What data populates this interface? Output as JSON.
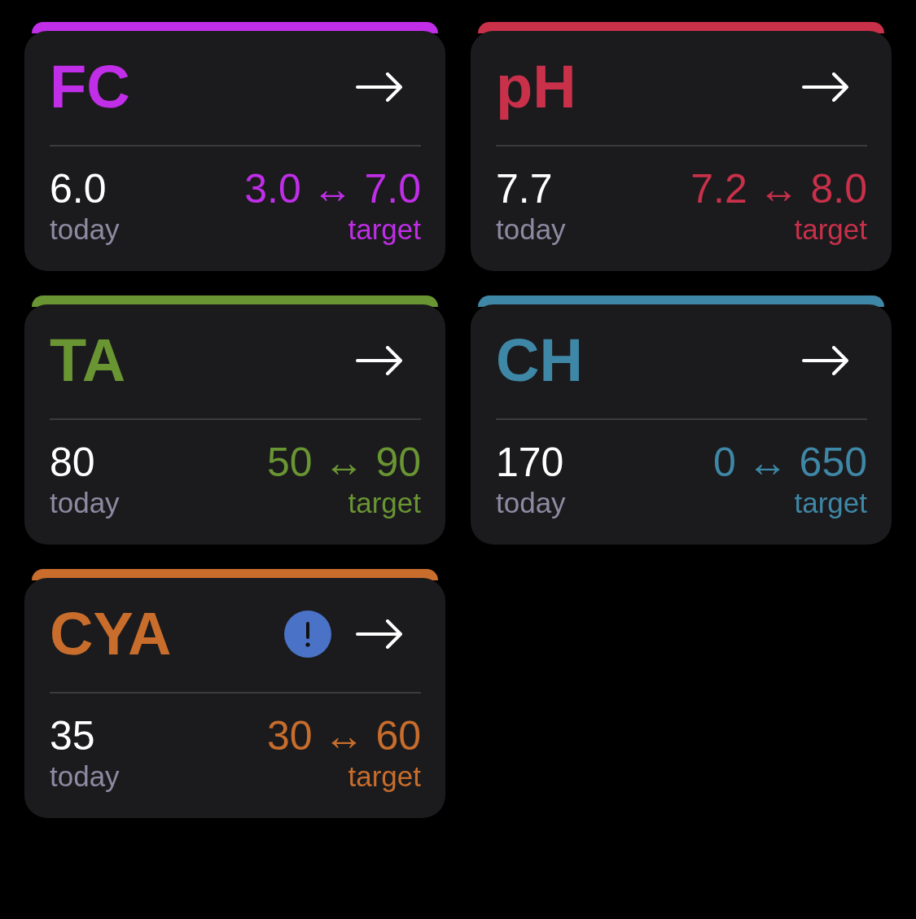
{
  "cards": [
    {
      "title": "FC",
      "color": "#c02ee8",
      "alert": false,
      "today_value": "6.0",
      "today_label": "today",
      "target_range": "3.0 ↔ 7.0",
      "target_label": "target"
    },
    {
      "title": "pH",
      "color": "#c9304a",
      "alert": false,
      "today_value": "7.7",
      "today_label": "today",
      "target_range": "7.2 ↔ 8.0",
      "target_label": "target"
    },
    {
      "title": "TA",
      "color": "#6a9533",
      "alert": false,
      "today_value": "80",
      "today_label": "today",
      "target_range": "50 ↔ 90",
      "target_label": "target"
    },
    {
      "title": "CH",
      "color": "#3f87a6",
      "alert": false,
      "today_value": "170",
      "today_label": "today",
      "target_range": "0 ↔ 650",
      "target_label": "target"
    },
    {
      "title": "CYA",
      "color": "#c86d2c",
      "alert": true,
      "today_value": "35",
      "today_label": "today",
      "target_range": "30 ↔ 60",
      "target_label": "target"
    }
  ]
}
